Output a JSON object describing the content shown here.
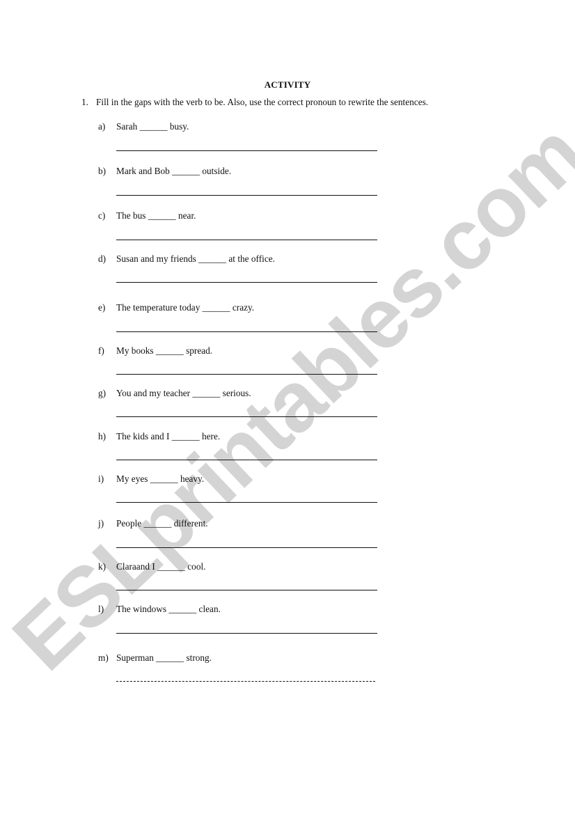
{
  "watermark": "ESLprintables.com",
  "title": "ACTIVITY",
  "instruction": {
    "number": "1.",
    "text": "Fill in the gaps with the verb to be. Also, use the correct pronoun to rewrite the sentences."
  },
  "items": [
    {
      "label": "a)",
      "sentence": "Sarah ______ busy."
    },
    {
      "label": "b)",
      "sentence": "Mark and Bob ______ outside."
    },
    {
      "label": "c)",
      "sentence": "The bus ______ near."
    },
    {
      "label": "d)",
      "sentence": "Susan and my friends ______ at the office."
    },
    {
      "label": "e)",
      "sentence": "The temperature today ______ crazy."
    },
    {
      "label": "f)",
      "sentence": "My books ______ spread."
    },
    {
      "label": "g)",
      "sentence": "You and my teacher ______ serious."
    },
    {
      "label": "h)",
      "sentence": "The kids and I ______ here."
    },
    {
      "label": "i)",
      "sentence": "My eyes ______ heavy."
    },
    {
      "label": "j)",
      "sentence": "People ______ different."
    },
    {
      "label": "k)",
      "sentence": "Claraand I ______ cool."
    },
    {
      "label": "l)",
      "sentence": "The windows ______ clean."
    },
    {
      "label": "m)",
      "sentence": "Superman ______ strong."
    }
  ]
}
